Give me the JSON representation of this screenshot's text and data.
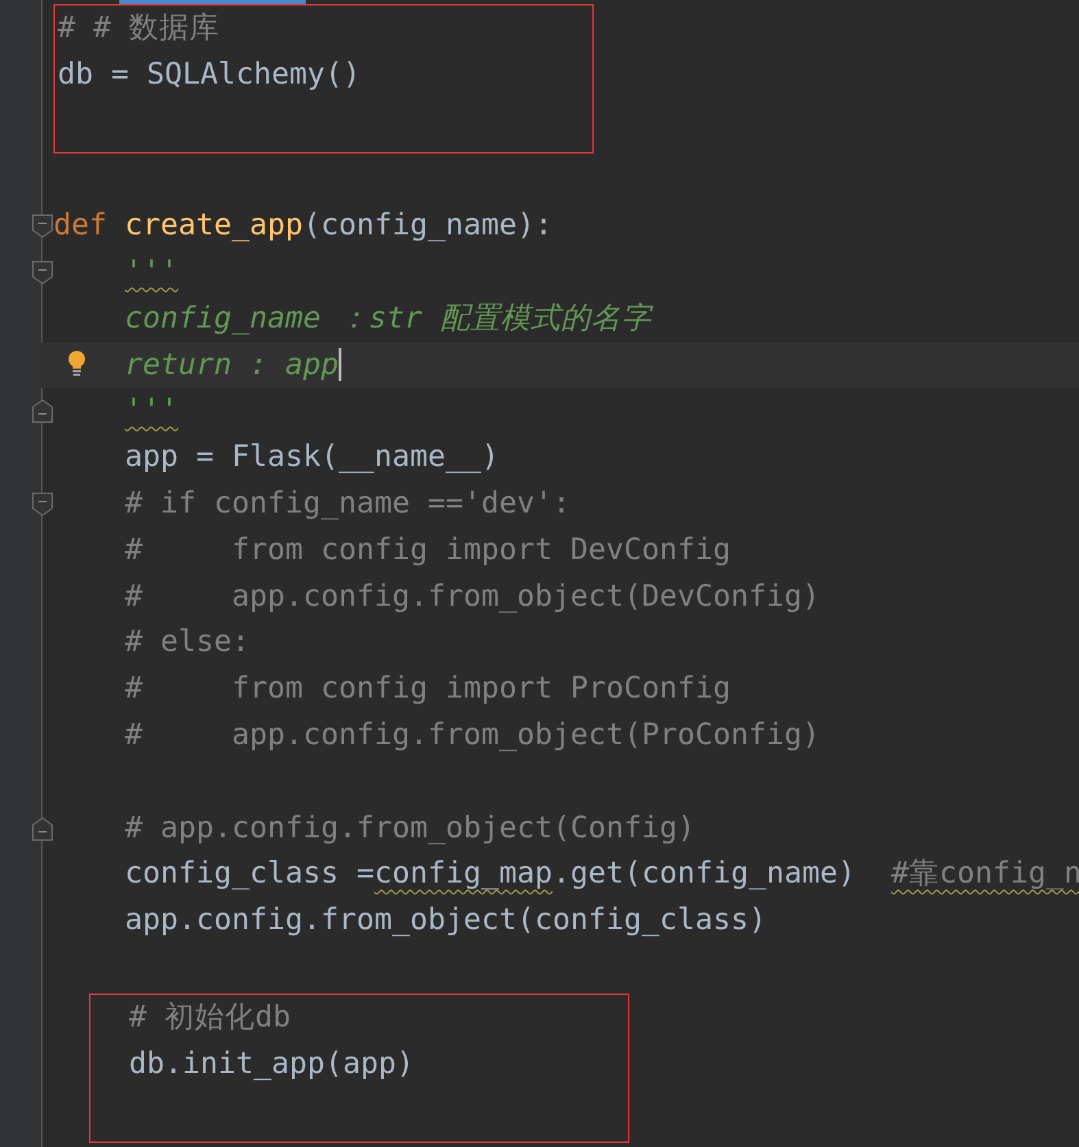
{
  "editor": {
    "active_tab_indicator": true,
    "blocks": [
      {
        "boxed": true,
        "lines": [
          {
            "kind": "code",
            "tokens": [
              {
                "text": "# # 数据库",
                "kind": "comment"
              }
            ]
          },
          {
            "kind": "code",
            "tokens": [
              {
                "text": "db = SQLAlchemy()",
                "kind": "plain"
              }
            ]
          },
          {
            "kind": "blank"
          }
        ]
      },
      {
        "boxed": false,
        "lines": [
          {
            "kind": "blank"
          },
          {
            "kind": "code",
            "fold_start": true,
            "tokens": [
              {
                "text": "def",
                "kind": "keyword"
              },
              {
                "text": " create_app",
                "kind": "function"
              },
              {
                "text": "(config_name):",
                "kind": "plain"
              }
            ]
          },
          {
            "kind": "code",
            "fold_start": true,
            "tokens": [
              {
                "text": "    '''",
                "kind": "docstring",
                "squiggly": true
              }
            ]
          },
          {
            "kind": "code",
            "tokens": [
              {
                "text": "    config_name ：str 配置模式的名字",
                "kind": "docstring"
              }
            ]
          },
          {
            "kind": "code",
            "current": true,
            "bulb": true,
            "caret": true,
            "tokens": [
              {
                "text": "    return : app",
                "kind": "docstring"
              }
            ]
          },
          {
            "kind": "code",
            "fold_end": true,
            "tokens": [
              {
                "text": "    '''",
                "kind": "docstring",
                "squiggly": true
              }
            ]
          },
          {
            "kind": "code",
            "tokens": [
              {
                "text": "    app = Flask(__name__)",
                "kind": "plain"
              }
            ]
          },
          {
            "kind": "code",
            "fold_start": true,
            "tokens": [
              {
                "text": "    # if config_name =='dev':",
                "kind": "comment"
              }
            ]
          },
          {
            "kind": "code",
            "tokens": [
              {
                "text": "    #     from config import DevConfig",
                "kind": "comment"
              }
            ]
          },
          {
            "kind": "code",
            "tokens": [
              {
                "text": "    #     app.config.from_object(DevConfig)",
                "kind": "comment"
              }
            ]
          },
          {
            "kind": "code",
            "tokens": [
              {
                "text": "    # else:",
                "kind": "comment"
              }
            ]
          },
          {
            "kind": "code",
            "tokens": [
              {
                "text": "    #     from config import ProConfig",
                "kind": "comment"
              }
            ]
          },
          {
            "kind": "code",
            "tokens": [
              {
                "text": "    #     app.config.from_object(ProConfig)",
                "kind": "comment"
              }
            ]
          },
          {
            "kind": "blank"
          },
          {
            "kind": "code",
            "fold_end": true,
            "tokens": [
              {
                "text": "    # app.config.from_object(Config)",
                "kind": "comment"
              }
            ]
          },
          {
            "kind": "code",
            "tokens": [
              {
                "text": "    config_class =",
                "kind": "plain"
              },
              {
                "text": "config_map",
                "kind": "plain",
                "squiggly": true
              },
              {
                "text": ".get(config_name)  ",
                "kind": "plain"
              },
              {
                "text": "#靠config_n",
                "kind": "comment",
                "squiggly": true
              }
            ]
          },
          {
            "kind": "code",
            "tokens": [
              {
                "text": "    app.config.from_object(config_class)",
                "kind": "plain"
              }
            ]
          },
          {
            "kind": "blank"
          }
        ]
      },
      {
        "boxed": true,
        "lines": [
          {
            "kind": "code",
            "tokens": [
              {
                "text": "    # 初始化db",
                "kind": "comment"
              }
            ]
          },
          {
            "kind": "code",
            "tokens": [
              {
                "text": "    db.init_app(app)",
                "kind": "plain"
              }
            ]
          },
          {
            "kind": "blank"
          }
        ]
      }
    ]
  }
}
